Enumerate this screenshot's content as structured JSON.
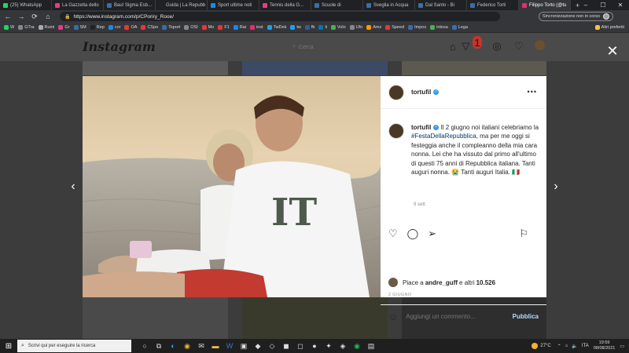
{
  "browser": {
    "tabs": [
      {
        "label": "(25) WhatsApp",
        "color": "#25d366"
      },
      {
        "label": "La Gazzetta dello",
        "color": "#e43b8c"
      },
      {
        "label": "Bau! Sigma Esb...",
        "color": "#3a6ea5"
      },
      {
        "label": "Guida | La Repubb",
        "color": "#222222"
      },
      {
        "label": "Sport ultime noti",
        "color": "#1e88e5"
      },
      {
        "label": "Tennis della G...",
        "color": "#e43b8c"
      },
      {
        "label": "Scuole di",
        "color": "#3a6ea5"
      },
      {
        "label": "Sveglia in Acqua",
        "color": "#3a6ea5"
      },
      {
        "label": "Dal Santo - Bi",
        "color": "#3a6ea5"
      },
      {
        "label": "Federico Torti",
        "color": "#3a6ea5"
      },
      {
        "label": "Filippo Torto (@tu",
        "color": "#e1306c",
        "active": true
      }
    ],
    "new_tab": "+",
    "url": "https://www.instagram.com/p/CPoriry_Rooe/",
    "sync_label": "Sincronizzazione non in corso",
    "bookmarks": [
      {
        "label": "W",
        "color": "#25d366"
      },
      {
        "label": "GTra",
        "color": "#888888"
      },
      {
        "label": "Rumi",
        "color": "#aaaaaa"
      },
      {
        "label": "Gr",
        "color": "#e43b8c"
      },
      {
        "label": "SM",
        "color": "#3a6ea5"
      },
      {
        "label": "Rep",
        "color": "#222222"
      },
      {
        "label": "cor",
        "color": "#1e88e5"
      },
      {
        "label": "OA",
        "color": "#e53935"
      },
      {
        "label": "CSpo",
        "color": "#e53935"
      },
      {
        "label": "Tsport",
        "color": "#3a6ea5"
      },
      {
        "label": "OSI",
        "color": "#888888"
      },
      {
        "label": "Mo",
        "color": "#e53935"
      },
      {
        "label": "F1",
        "color": "#e53935"
      },
      {
        "label": "Rai",
        "color": "#1e88e5"
      },
      {
        "label": "inst",
        "color": "#e1306c"
      },
      {
        "label": "TwDek",
        "color": "#1da1f2"
      },
      {
        "label": "tw",
        "color": "#1da1f2"
      },
      {
        "label": "fb",
        "color": "#3b5998"
      },
      {
        "label": "li",
        "color": "#0077b5"
      },
      {
        "label": "Volo",
        "color": "#4caf50"
      },
      {
        "label": "Ufo",
        "color": "#888888"
      },
      {
        "label": "Amz",
        "color": "#ff9900"
      },
      {
        "label": "Speed",
        "color": "#e53935"
      },
      {
        "label": "Impos",
        "color": "#3a6ea5"
      },
      {
        "label": "intesa",
        "color": "#4caf50"
      },
      {
        "label": "Lega",
        "color": "#3a6ea5"
      }
    ],
    "other_bookmarks": "Altri preferiti"
  },
  "instagram": {
    "logo": "Instagram",
    "search_placeholder": "Cerca",
    "notif_count": "1",
    "nav_icons": [
      "home-icon",
      "direct-icon",
      "explore-icon",
      "heart-icon",
      "profile-avatar"
    ]
  },
  "post": {
    "username": "tortufil",
    "more": "•••",
    "caption_user": "tortufil",
    "caption_pre": "Il 2 giugno noi italiani celebriamo la ",
    "caption_hashtag": "#FestaDellaRepubblica",
    "caption_post": ", ma per me oggi si festeggia anche il compleanno della mia cara nonna. Lei che ha vissuto dal primo all'ultimo di questi 75 anni di Repubblica italiana. Tanti auguri nonna. 😭 Tanti auguri Italia. 🇮🇹",
    "time": "9 sett.",
    "likes_prefix": "Piace a ",
    "likes_user": "andre_guff",
    "likes_suffix": " e altri ",
    "likes_count": "10.526",
    "date": "2 GIUGNO",
    "comment_placeholder": "Aggiungi un commento...",
    "publish": "Pubblica"
  },
  "taskbar": {
    "search": "Scrivi qui per eseguire la ricerca",
    "temperature": "27°C",
    "time": "19:59",
    "date": "08/08/2021"
  }
}
